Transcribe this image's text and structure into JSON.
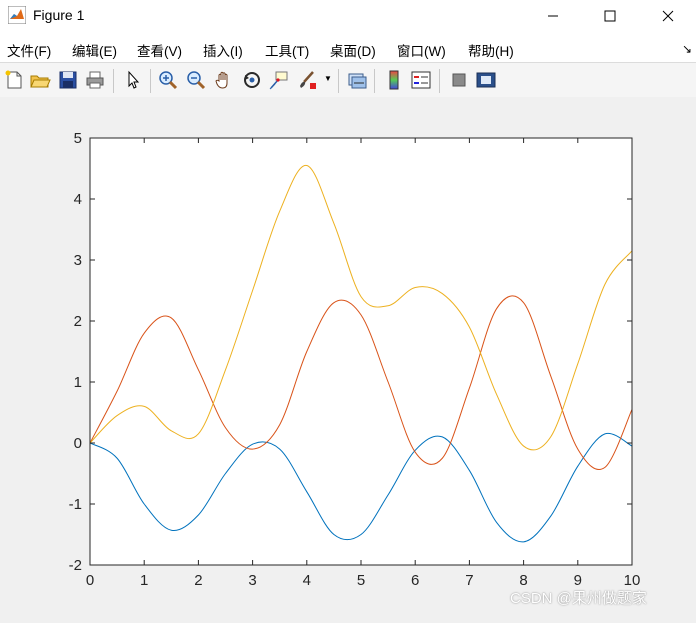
{
  "window": {
    "title": "Figure 1"
  },
  "menu": [
    {
      "label": "文件(F)"
    },
    {
      "label": "编辑(E)"
    },
    {
      "label": "查看(V)"
    },
    {
      "label": "插入(I)"
    },
    {
      "label": "工具(T)"
    },
    {
      "label": "桌面(D)"
    },
    {
      "label": "窗口(W)"
    },
    {
      "label": "帮助(H)"
    }
  ],
  "toolbar_icons": [
    "new-figure-icon",
    "open-file-icon",
    "save-icon",
    "print-icon",
    "pointer-icon",
    "zoom-in-icon",
    "zoom-out-icon",
    "pan-hand-icon",
    "rotate-3d-icon",
    "data-cursor-icon",
    "brush-icon",
    "link-plot-icon",
    "colorbar-icon",
    "legend-icon",
    "hide-plot-tools-icon",
    "show-plot-tools-icon"
  ],
  "watermark": "CSDN @果州做题家",
  "chart_data": {
    "type": "line",
    "xlim": [
      0,
      10
    ],
    "ylim": [
      -2,
      5
    ],
    "xticks": [
      "0",
      "1",
      "2",
      "3",
      "4",
      "5",
      "6",
      "7",
      "8",
      "9",
      "10"
    ],
    "yticks": [
      "-2",
      "-1",
      "0",
      "1",
      "2",
      "3",
      "4",
      "5"
    ],
    "grid": false,
    "series": [
      {
        "color": "#0072BD",
        "x": [
          0,
          0.5,
          1,
          1.5,
          2,
          2.5,
          3,
          3.5,
          4,
          4.5,
          5,
          5.5,
          6,
          6.5,
          7,
          7.5,
          8,
          8.5,
          9,
          9.5,
          10
        ],
        "y": [
          0,
          -0.25,
          -1.0,
          -1.43,
          -1.18,
          -0.5,
          -0.02,
          -0.1,
          -0.8,
          -1.5,
          -1.5,
          -0.85,
          -0.12,
          0.1,
          -0.45,
          -1.3,
          -1.62,
          -1.2,
          -0.38,
          0.15,
          -0.05
        ]
      },
      {
        "color": "#D95319",
        "x": [
          0,
          0.5,
          1,
          1.5,
          2,
          2.5,
          3,
          3.5,
          4,
          4.5,
          5,
          5.5,
          6,
          6.5,
          7,
          7.5,
          8,
          8.5,
          9,
          9.5,
          10
        ],
        "y": [
          0,
          0.85,
          1.8,
          2.05,
          1.2,
          0.25,
          -0.1,
          0.3,
          1.5,
          2.3,
          2.1,
          1.0,
          -0.15,
          -0.25,
          0.9,
          2.2,
          2.3,
          1.1,
          -0.1,
          -0.4,
          0.55
        ]
      },
      {
        "color": "#EDB120",
        "x": [
          0,
          0.5,
          1,
          1.5,
          2,
          2.5,
          3,
          3.5,
          4,
          4.5,
          5,
          5.5,
          6,
          6.5,
          7,
          7.5,
          8,
          8.5,
          9,
          9.5,
          10
        ],
        "y": [
          0,
          0.45,
          0.6,
          0.2,
          0.15,
          1.2,
          2.5,
          3.8,
          4.55,
          3.6,
          2.4,
          2.25,
          2.55,
          2.45,
          1.9,
          0.8,
          -0.05,
          0.1,
          1.3,
          2.6,
          3.15
        ]
      }
    ]
  }
}
